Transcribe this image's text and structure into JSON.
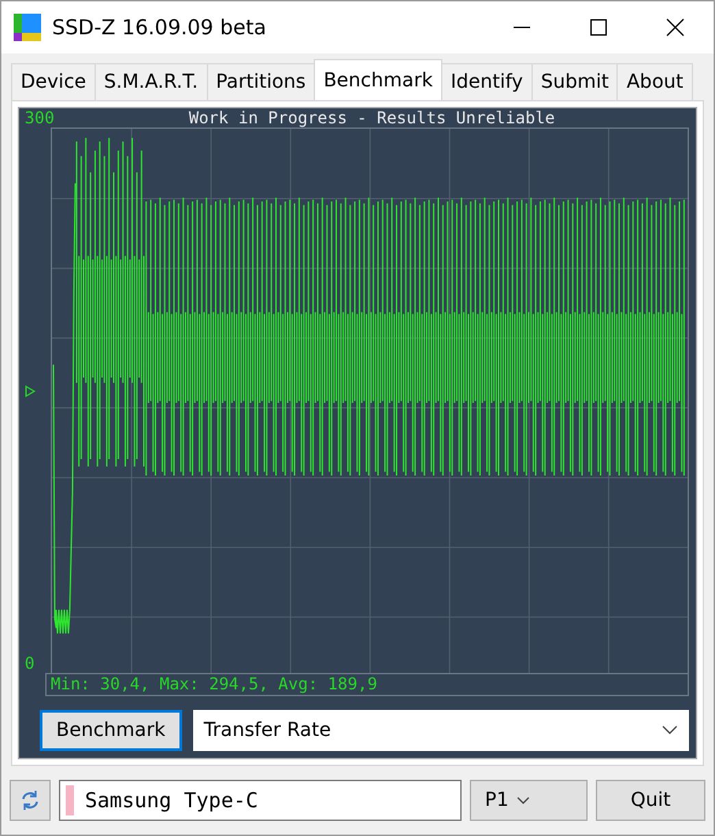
{
  "window": {
    "title": "SSD-Z 16.09.09 beta"
  },
  "tabs": [
    {
      "label": "Device",
      "selected": false
    },
    {
      "label": "S.M.A.R.T.",
      "selected": false
    },
    {
      "label": "Partitions",
      "selected": false
    },
    {
      "label": "Benchmark",
      "selected": true
    },
    {
      "label": "Identify",
      "selected": false
    },
    {
      "label": "Submit",
      "selected": false
    },
    {
      "label": "About",
      "selected": false
    }
  ],
  "chart": {
    "title": "Work in Progress - Results Unreliable",
    "y_top_label": "300",
    "y_bottom_label": "0",
    "stats": "Min: 30,4, Max: 294,5, Avg: 189,9"
  },
  "controls": {
    "benchmark_button": "Benchmark",
    "mode_select": {
      "value": "Transfer Rate"
    }
  },
  "status_bar": {
    "drive": {
      "value": "Samsung Type-C"
    },
    "profile_button": "P1",
    "quit_button": "Quit"
  }
}
